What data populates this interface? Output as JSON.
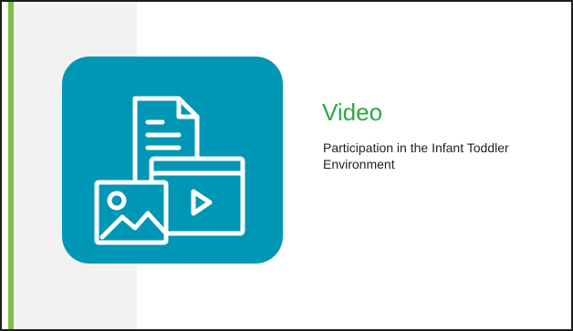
{
  "slide": {
    "title": "Video",
    "subtitle": "Participation in the Infant Toddler Environment",
    "icon": "document-image-video-icon"
  },
  "colors": {
    "accent_bar": "#7cc04b",
    "icon_tile": "#0096b5",
    "title": "#2ea843",
    "left_panel": "#f2f2f2"
  }
}
